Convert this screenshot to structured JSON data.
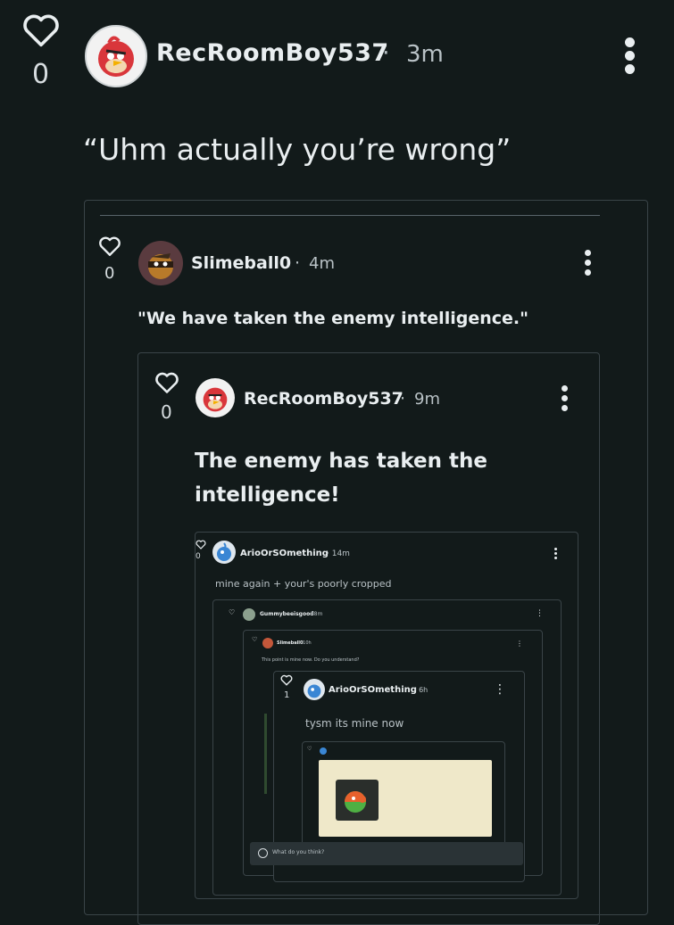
{
  "colors": {
    "background": "#121a1a",
    "text": "#e9eef0",
    "frame_border": "#3a4448",
    "avatar_red": "#d9363b"
  },
  "main_post": {
    "like_count": "0",
    "username": "RecRoomBoy537",
    "separator": "·",
    "time": "3m",
    "text": "“Uhm actually you’re wrong”"
  },
  "quote_1": {
    "like_count": "0",
    "username": "Slimeball0",
    "separator": "·",
    "time": "4m",
    "text": "\"We have taken the enemy intelligence.\""
  },
  "quote_2": {
    "like_count": "0",
    "username": "RecRoomBoy537",
    "separator": "·",
    "time": "9m",
    "text_line1": "The enemy has taken the",
    "text_line2": "intelligence!"
  },
  "quote_3": {
    "like_count": "0",
    "username": "ArioOrSOmething",
    "time": "· 14m",
    "text": "mine again + your's poorly cropped"
  },
  "quote_4": {
    "username": "Gummybeeisgood",
    "time": "· 38m"
  },
  "quote_5": {
    "username": "Slimeball0",
    "time": "· 10h",
    "text": "This point is mine now. Do you understand?"
  },
  "quote_6": {
    "like_count": "1",
    "username": "ArioOrSOmething",
    "time": "· 6h",
    "text": "tysm its mine now"
  },
  "comment_bar": {
    "placeholder": "What do you think?"
  },
  "icons": [
    "heart-icon",
    "more-vert-icon",
    "avatar-angry-bird",
    "avatar-ninja",
    "avatar-blue-creature"
  ]
}
